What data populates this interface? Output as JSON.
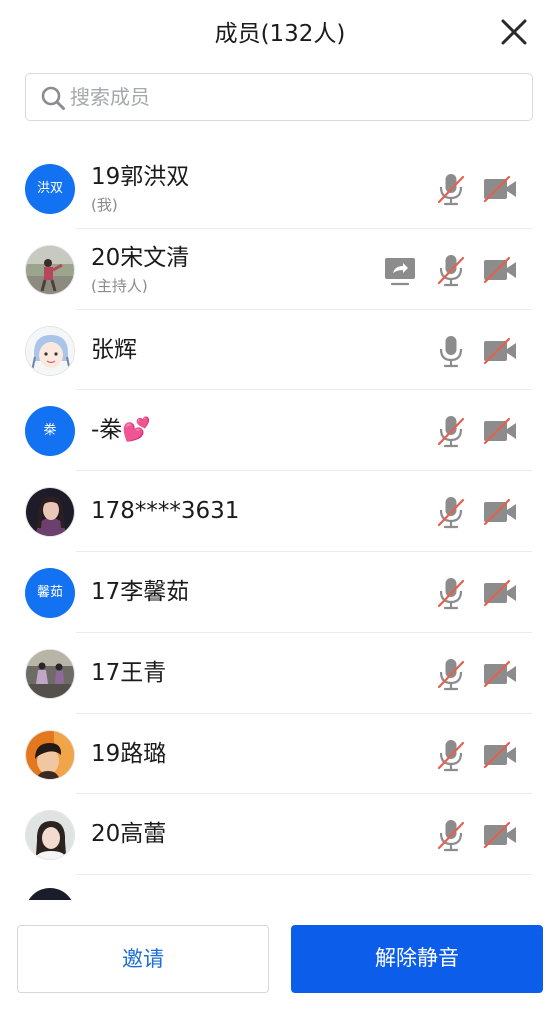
{
  "header": {
    "title": "成员(132人)"
  },
  "search": {
    "placeholder": "搜索成员"
  },
  "members": [
    {
      "name": "19郭洪双",
      "role": "(我)",
      "avatar_text": "洪双",
      "mic": "muted",
      "camera": "off",
      "sharing": false
    },
    {
      "name": "20宋文清",
      "role": "(主持人)",
      "avatar_icon": "photo-person-outdoor",
      "mic": "muted",
      "camera": "off",
      "sharing": true
    },
    {
      "name": "张辉",
      "avatar_icon": "photo-cartoon-girl",
      "mic": "on",
      "camera": "off",
      "sharing": false
    },
    {
      "name": "-桊💕",
      "avatar_text": "桊",
      "mic": "muted",
      "camera": "off",
      "sharing": false
    },
    {
      "name": "178****3631",
      "avatar_icon": "photo-portrait",
      "mic": "muted",
      "camera": "off",
      "sharing": false
    },
    {
      "name": "17李馨茹",
      "avatar_text": "馨茹",
      "mic": "muted",
      "camera": "off",
      "sharing": false
    },
    {
      "name": "17王青",
      "avatar_icon": "photo-dancers",
      "mic": "muted",
      "camera": "off",
      "sharing": false
    },
    {
      "name": "19路璐",
      "avatar_icon": "photo-boy",
      "mic": "muted",
      "camera": "off",
      "sharing": false
    },
    {
      "name": "20高蕾",
      "avatar_icon": "photo-girl",
      "mic": "muted",
      "camera": "off",
      "sharing": false
    }
  ],
  "footer": {
    "invite_label": "邀请",
    "unmute_label": "解除静音"
  },
  "colors": {
    "accent": "#0c5de9",
    "avatar_blue": "#1272f1",
    "muted_slash": "#e0624f",
    "icon_gray": "#8c8c8c"
  }
}
